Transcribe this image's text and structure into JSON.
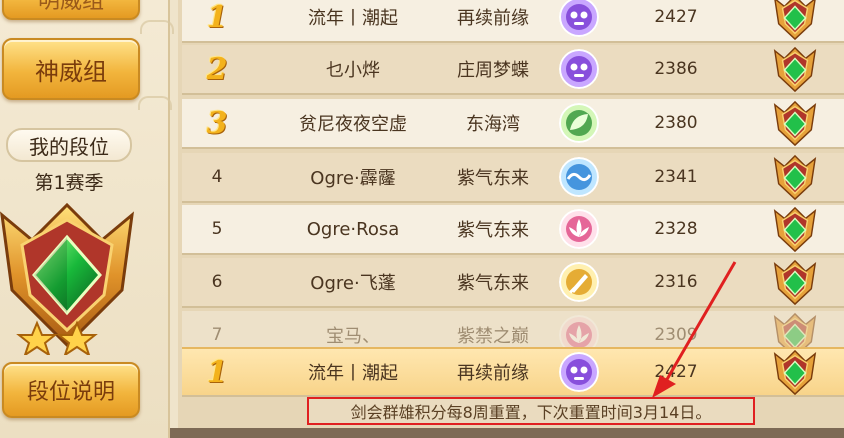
{
  "sidebar": {
    "top_button_label": "明威组",
    "group_button_label": "神威组",
    "my_rank_label": "我的段位",
    "season_label": "第1赛季",
    "explain_button_label": "段位说明"
  },
  "rows": [
    {
      "rank": "1",
      "name": "流年丨潮起",
      "server": "再续前缘",
      "school_icon": "purple-skull-icon",
      "score": "2427"
    },
    {
      "rank": "2",
      "name": "乜小烨",
      "server": "庄周梦蝶",
      "school_icon": "purple-skull-icon",
      "score": "2386"
    },
    {
      "rank": "3",
      "name": "贫尼夜夜空虚",
      "server": "东海湾",
      "school_icon": "green-leaf-icon",
      "score": "2380"
    },
    {
      "rank": "4",
      "name": "Ogre·霹霳",
      "server": "紫气东来",
      "school_icon": "blue-wave-icon",
      "score": "2341"
    },
    {
      "rank": "5",
      "name": "Ogre·Rosa",
      "server": "紫气东来",
      "school_icon": "pink-lotus-icon",
      "score": "2328"
    },
    {
      "rank": "6",
      "name": "Ogre·飞蓬",
      "server": "紫气东来",
      "school_icon": "gold-sword-icon",
      "score": "2316"
    },
    {
      "rank": "7",
      "name": "宝马、",
      "server": "紫禁之巅",
      "school_icon": "pink-lotus-icon",
      "score": "2309"
    }
  ],
  "my_row": {
    "rank": "1",
    "name": "流年丨潮起",
    "server": "再续前缘",
    "school_icon": "purple-skull-icon",
    "score": "2427"
  },
  "notice": "剑会群雄积分每8周重置，下次重置时间3月14日。",
  "colors": {
    "gold_button": "#f2b53d",
    "rank_gold": "#f3b21c",
    "notice_border": "#e02020",
    "arrow": "#e02020"
  }
}
